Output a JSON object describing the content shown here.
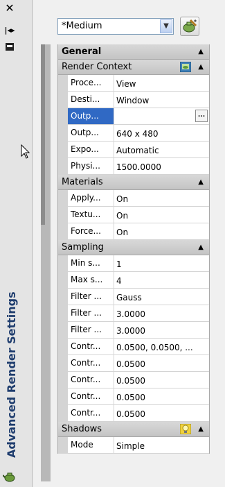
{
  "palette": {
    "title": "Advanced Render Settings"
  },
  "toolbar": {
    "preset_value": "*Medium",
    "preset_dropdown_icon": "chevron-down-icon",
    "tool_icon": "render-settings-icon"
  },
  "groups": [
    {
      "label": "General",
      "bold": true,
      "rows": []
    },
    {
      "label": "Render Context",
      "icon": "render-context-icon",
      "rows": [
        {
          "name": "Proce...",
          "value": "View"
        },
        {
          "name": "Desti...",
          "value": "Window"
        },
        {
          "name": "Outp...",
          "value": "",
          "selected": true
        },
        {
          "name": "Outp...",
          "value": "640 x 480"
        },
        {
          "name": "Expo...",
          "value": "Automatic"
        },
        {
          "name": "Physi...",
          "value": "1500.0000"
        }
      ]
    },
    {
      "label": "Materials",
      "rows": [
        {
          "name": "Apply...",
          "value": "On"
        },
        {
          "name": "Textu...",
          "value": "On"
        },
        {
          "name": "Force...",
          "value": "On"
        }
      ]
    },
    {
      "label": "Sampling",
      "rows": [
        {
          "name": "Min s...",
          "value": "1"
        },
        {
          "name": "Max s...",
          "value": "4"
        },
        {
          "name": "Filter ...",
          "value": "Gauss"
        },
        {
          "name": "Filter ...",
          "value": "3.0000"
        },
        {
          "name": "Filter ...",
          "value": "3.0000"
        },
        {
          "name": "Contr...",
          "value": "0.0500, 0.0500, ..."
        },
        {
          "name": "Contr...",
          "value": "0.0500"
        },
        {
          "name": "Contr...",
          "value": "0.0500"
        },
        {
          "name": "Contr...",
          "value": "0.0500"
        },
        {
          "name": "Contr...",
          "value": "0.0500"
        }
      ]
    },
    {
      "label": "Shadows",
      "icon": "light-bulb-icon",
      "rows": [
        {
          "name": "Mode",
          "value": "Simple"
        }
      ]
    }
  ],
  "ellipsis_label": "..."
}
